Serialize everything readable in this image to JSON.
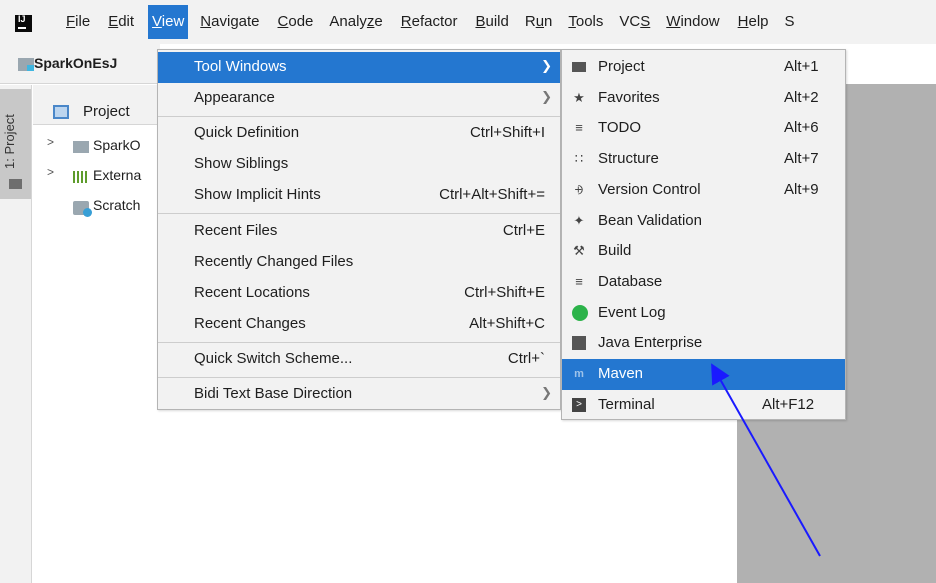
{
  "menubar": {
    "items": [
      {
        "pre": "",
        "u": "F",
        "post": "ile"
      },
      {
        "pre": "",
        "u": "E",
        "post": "dit"
      },
      {
        "pre": "",
        "u": "V",
        "post": "iew"
      },
      {
        "pre": "",
        "u": "N",
        "post": "avigate"
      },
      {
        "pre": "",
        "u": "C",
        "post": "ode"
      },
      {
        "pre": "Analy",
        "u": "z",
        "post": "e"
      },
      {
        "pre": "",
        "u": "R",
        "post": "efactor"
      },
      {
        "pre": "",
        "u": "B",
        "post": "uild"
      },
      {
        "pre": "R",
        "u": "u",
        "post": "n"
      },
      {
        "pre": "",
        "u": "T",
        "post": "ools"
      },
      {
        "pre": "VC",
        "u": "S",
        "post": ""
      },
      {
        "pre": "",
        "u": "W",
        "post": "indow"
      },
      {
        "pre": "",
        "u": "H",
        "post": "elp"
      },
      {
        "pre": "S",
        "u": "",
        "post": ""
      }
    ],
    "active_index": 2
  },
  "navbar": {
    "crumb": "SparkOnEsJ"
  },
  "tool_stripe": {
    "tab_label": "1: Project"
  },
  "project_panel": {
    "title": "Project",
    "rows": [
      {
        "chev": ">",
        "text": "SparkO"
      },
      {
        "chev": ">",
        "text": "Externa"
      },
      {
        "chev": "",
        "text": "Scratch"
      }
    ]
  },
  "view_menu": {
    "items": [
      {
        "label": "Tool Windows",
        "shortcut": "",
        "submenu": true,
        "selected": true
      },
      {
        "label": "Appearance",
        "shortcut": "",
        "submenu": true,
        "selected": false
      },
      {
        "label": "Quick Definition",
        "shortcut": "Ctrl+Shift+I",
        "submenu": false,
        "selected": false
      },
      {
        "label": "Show Siblings",
        "shortcut": "",
        "submenu": false,
        "selected": false
      },
      {
        "label": "Show Implicit Hints",
        "shortcut": "Ctrl+Alt+Shift+=",
        "submenu": false,
        "selected": false
      },
      {
        "label": "Recent Files",
        "shortcut": "Ctrl+E",
        "submenu": false,
        "selected": false
      },
      {
        "label": "Recently Changed Files",
        "shortcut": "",
        "submenu": false,
        "selected": false
      },
      {
        "label": "Recent Locations",
        "shortcut": "Ctrl+Shift+E",
        "submenu": false,
        "selected": false
      },
      {
        "label": "Recent Changes",
        "shortcut": "Alt+Shift+C",
        "submenu": false,
        "selected": false
      },
      {
        "label": "Quick Switch Scheme...",
        "shortcut": "Ctrl+`",
        "submenu": false,
        "selected": false
      },
      {
        "label": "Bidi Text Base Direction",
        "shortcut": "",
        "submenu": true,
        "selected": false
      }
    ]
  },
  "tool_windows_menu": {
    "items": [
      {
        "label": "Project",
        "shortcut": "Alt+1",
        "icon": "folder-icon"
      },
      {
        "label": "Favorites",
        "shortcut": "Alt+2",
        "icon": "star-icon"
      },
      {
        "label": "TODO",
        "shortcut": "Alt+6",
        "icon": "todo-icon"
      },
      {
        "label": "Structure",
        "shortcut": "Alt+7",
        "icon": "structure-icon"
      },
      {
        "label": "Version Control",
        "shortcut": "Alt+9",
        "icon": "version-control-icon"
      },
      {
        "label": "Bean Validation",
        "shortcut": "",
        "icon": "bean-validation-icon"
      },
      {
        "label": "Build",
        "shortcut": "",
        "icon": "build-hammer-icon"
      },
      {
        "label": "Database",
        "shortcut": "",
        "icon": "database-icon"
      },
      {
        "label": "Event Log",
        "shortcut": "",
        "icon": "event-log-icon"
      },
      {
        "label": "Java Enterprise",
        "shortcut": "",
        "icon": "java-enterprise-icon"
      },
      {
        "label": "Maven",
        "shortcut": "",
        "icon": "maven-icon",
        "selected": true
      },
      {
        "label": "Terminal",
        "shortcut": "Alt+F12",
        "icon": "terminal-icon"
      }
    ]
  },
  "colors": {
    "selection": "#2477d0",
    "menu_bg": "#f2f2f2",
    "annotation_arrow": "#1a1aff"
  }
}
